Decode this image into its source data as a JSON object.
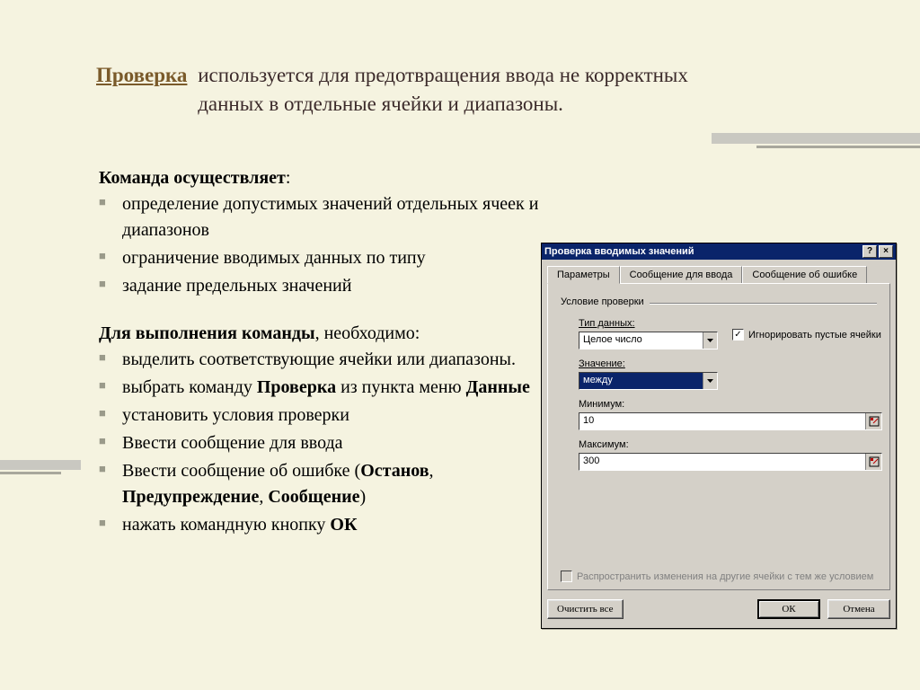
{
  "title": {
    "keyword": "Проверка",
    "desc_l1": "используется для предотвращения ввода не корректных",
    "desc_l2": "данных в отдельные ячейки и диапазоны."
  },
  "section1": {
    "heading_pre": "Команда осуществляет",
    "items": [
      "определение допустимых значений отдельных ячеек и   диапазонов",
      "ограничение вводимых данных по типу",
      "задание предельных значений"
    ]
  },
  "section2": {
    "heading_pre": "Для выполнения команды",
    "heading_post": ", необходимо:",
    "items": [
      {
        "pre": "выделить соответствующие ячейки или диапазоны."
      },
      {
        "pre": "выбрать команду ",
        "b1": "Проверка",
        "mid": " из пункта меню ",
        "b2": "Данные"
      },
      {
        "pre": "установить условия проверки"
      },
      {
        "pre": "Ввести сообщение для ввода"
      },
      {
        "pre": "Ввести сообщение об ошибке (",
        "b1": "Останов",
        "mid": ", ",
        "b2": "Предупреждение",
        "mid2": ", ",
        "b3": "Сообщение",
        "post": ")"
      },
      {
        "pre": "нажать командную кнопку ",
        "b1": "ОК"
      }
    ]
  },
  "dialog": {
    "title": "Проверка вводимых значений",
    "help_btn": "?",
    "close_btn": "×",
    "tabs": [
      "Параметры",
      "Сообщение для ввода",
      "Сообщение об ошибке"
    ],
    "active_tab": 0,
    "group_label": "Условие проверки",
    "data_type_label": "Тип данных:",
    "data_type_value": "Целое число",
    "ignore_blank_label": "Игнорировать пустые ячейки",
    "value_label": "Значение:",
    "value_value": "между",
    "min_label": "Минимум:",
    "min_value": "10",
    "max_label": "Максимум:",
    "max_value": "300",
    "spread_label": "Распространить изменения на другие ячейки с тем же условием",
    "buttons": {
      "clear": "Очистить все",
      "ok": "ОК",
      "cancel": "Отмена"
    }
  }
}
